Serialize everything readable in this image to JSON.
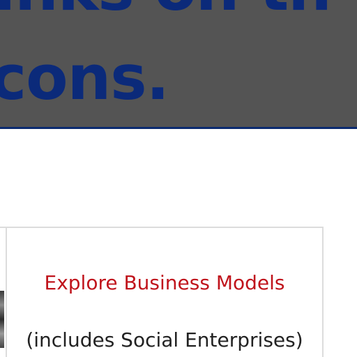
{
  "banner": {
    "heading_line_1": "inks on th",
    "heading_line_2": "cons."
  },
  "card": {
    "title": "Explore Business Models",
    "subtitle": "(includes Social Enterprises)"
  },
  "colors": {
    "banner_bg": "#545454",
    "heading_text": "#0b2a7a",
    "card_title": "#c0141c",
    "card_border": "#dcdcdc"
  }
}
